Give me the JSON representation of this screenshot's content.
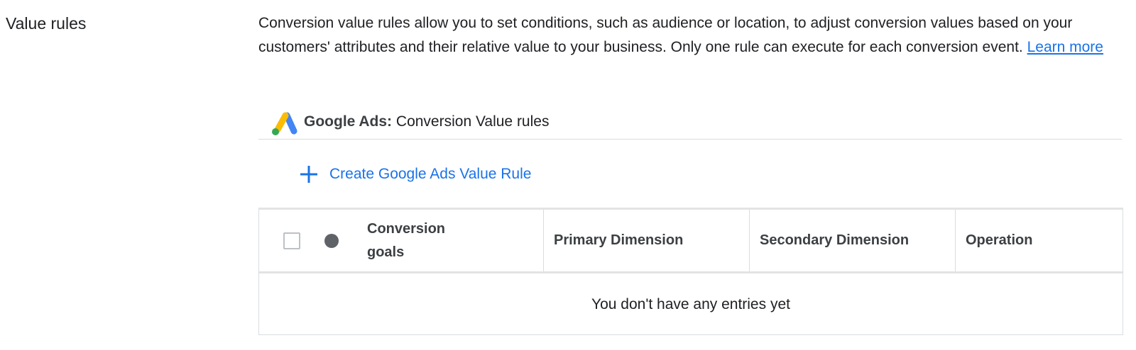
{
  "section": {
    "title": "Value rules"
  },
  "description": {
    "text": "Conversion value rules allow you to set conditions, such as audience or location, to adjust conversion values based on your customers' attributes and their relative value to your business. Only one rule can execute for each conversion event. ",
    "link": "Learn more",
    "link_color": "#1a73e8"
  },
  "ads_header": {
    "logo_icon": "google-ads-logo",
    "bold_label": "Google Ads:",
    "label": " Conversion Value rules"
  },
  "create_button": {
    "icon": "plus-icon",
    "label": "Create Google Ads Value Rule",
    "color": "#1a73e8"
  },
  "table": {
    "columns": [
      "Conversion goals",
      "Primary Dimension",
      "Secondary Dimension",
      "Operation"
    ],
    "status_dot_color": "#5f6368",
    "empty_message": "You don't have any entries yet"
  }
}
